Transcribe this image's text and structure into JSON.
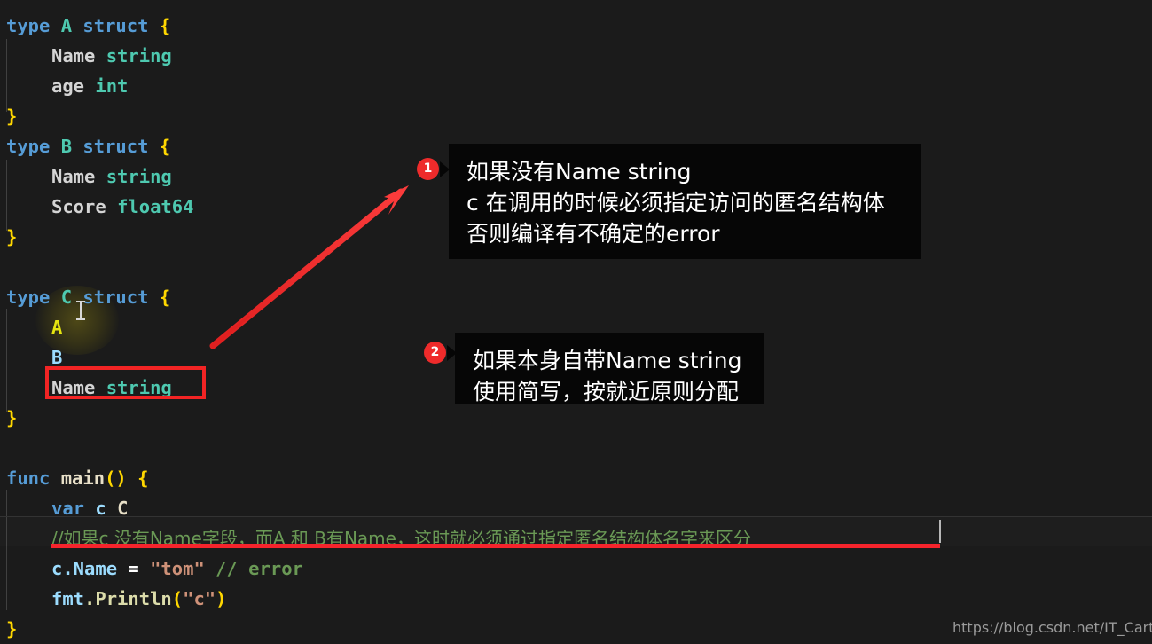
{
  "editor": {
    "background_color": "#1b1b1b",
    "language": "go",
    "lines": [
      {
        "n": 1,
        "indent": 0,
        "tokens": [
          {
            "t": "type ",
            "c": "kw"
          },
          {
            "t": "A",
            "c": "typ"
          },
          {
            "t": " ",
            "c": "ident"
          },
          {
            "t": "struct",
            "c": "kw"
          },
          {
            "t": " ",
            "c": "ident"
          },
          {
            "t": "{",
            "c": "brace"
          }
        ]
      },
      {
        "n": 2,
        "indent": 1,
        "tokens": [
          {
            "t": "Name",
            "c": "ident"
          },
          {
            "t": " ",
            "c": "ident"
          },
          {
            "t": "string",
            "c": "typ"
          }
        ]
      },
      {
        "n": 3,
        "indent": 1,
        "tokens": [
          {
            "t": "age",
            "c": "ident"
          },
          {
            "t": " ",
            "c": "ident"
          },
          {
            "t": "int",
            "c": "typ"
          }
        ]
      },
      {
        "n": 4,
        "indent": 0,
        "tokens": [
          {
            "t": "}",
            "c": "brace"
          }
        ]
      },
      {
        "n": 5,
        "indent": 0,
        "tokens": [
          {
            "t": "type ",
            "c": "kw"
          },
          {
            "t": "B",
            "c": "typ"
          },
          {
            "t": " ",
            "c": "ident"
          },
          {
            "t": "struct",
            "c": "kw"
          },
          {
            "t": " ",
            "c": "ident"
          },
          {
            "t": "{",
            "c": "brace"
          }
        ]
      },
      {
        "n": 6,
        "indent": 1,
        "tokens": [
          {
            "t": "Name",
            "c": "ident"
          },
          {
            "t": " ",
            "c": "ident"
          },
          {
            "t": "string",
            "c": "typ"
          }
        ]
      },
      {
        "n": 7,
        "indent": 1,
        "tokens": [
          {
            "t": "Score",
            "c": "ident"
          },
          {
            "t": " ",
            "c": "ident"
          },
          {
            "t": "float64",
            "c": "typ"
          }
        ]
      },
      {
        "n": 8,
        "indent": 0,
        "tokens": [
          {
            "t": "}",
            "c": "brace"
          }
        ]
      },
      {
        "n": 9,
        "indent": 0,
        "tokens": []
      },
      {
        "n": 10,
        "indent": 0,
        "tokens": [
          {
            "t": "type ",
            "c": "kw"
          },
          {
            "t": "C",
            "c": "typ"
          },
          {
            "t": " ",
            "c": "ident"
          },
          {
            "t": "struct",
            "c": "kw"
          },
          {
            "t": " ",
            "c": "ident"
          },
          {
            "t": "{",
            "c": "brace"
          }
        ]
      },
      {
        "n": 11,
        "indent": 1,
        "tokens": [
          {
            "t": "A",
            "c": "yellow"
          }
        ]
      },
      {
        "n": 12,
        "indent": 1,
        "tokens": [
          {
            "t": "B",
            "c": "prop"
          }
        ]
      },
      {
        "n": 13,
        "indent": 1,
        "tokens": [
          {
            "t": "Name",
            "c": "ident"
          },
          {
            "t": " ",
            "c": "ident"
          },
          {
            "t": "string",
            "c": "typ"
          }
        ]
      },
      {
        "n": 14,
        "indent": 0,
        "tokens": [
          {
            "t": "}",
            "c": "brace"
          }
        ]
      },
      {
        "n": 15,
        "indent": 0,
        "tokens": []
      },
      {
        "n": 16,
        "indent": 0,
        "tokens": [
          {
            "t": "func ",
            "c": "kw"
          },
          {
            "t": "main",
            "c": "cream"
          },
          {
            "t": "()",
            "c": "brace"
          },
          {
            "t": " ",
            "c": "ident"
          },
          {
            "t": "{",
            "c": "brace"
          }
        ]
      },
      {
        "n": 17,
        "indent": 1,
        "tokens": [
          {
            "t": "var",
            "c": "kw"
          },
          {
            "t": " ",
            "c": "ident"
          },
          {
            "t": "c",
            "c": "prop"
          },
          {
            "t": " ",
            "c": "ident"
          },
          {
            "t": "C",
            "c": "cream"
          }
        ]
      },
      {
        "n": 18,
        "indent": 1,
        "tokens": [
          {
            "t": "//如果c 没有Name字段，而A 和 B有Name，这时就必须通过指定匿名结构体名字来区分",
            "c": "cmt"
          }
        ]
      },
      {
        "n": 19,
        "indent": 1,
        "tokens": [
          {
            "t": "c",
            "c": "prop"
          },
          {
            "t": ".Name",
            "c": "prop"
          },
          {
            "t": " ",
            "c": "ident"
          },
          {
            "t": "=",
            "c": "white"
          },
          {
            "t": " ",
            "c": "ident"
          },
          {
            "t": "\"tom\"",
            "c": "str"
          },
          {
            "t": " ",
            "c": "ident"
          },
          {
            "t": "// error",
            "c": "cmt"
          }
        ]
      },
      {
        "n": 20,
        "indent": 1,
        "tokens": [
          {
            "t": "fmt",
            "c": "prop"
          },
          {
            "t": ".Println",
            "c": "fn"
          },
          {
            "t": "(",
            "c": "brace"
          },
          {
            "t": "\"c\"",
            "c": "str"
          },
          {
            "t": ")",
            "c": "brace"
          }
        ]
      },
      {
        "n": 21,
        "indent": 0,
        "tokens": [
          {
            "t": "}",
            "c": "brace"
          }
        ]
      }
    ],
    "cursor_line": 18,
    "highlighted_identifier": "A",
    "boxed_code": "Name string"
  },
  "annotations": [
    {
      "number": "1",
      "text": "如果没有Name string\nc 在调用的时候必须指定访问的匿名结构体\n否则编译有不确定的error",
      "badge_color": "#ee2b2b",
      "box_color": "#060606"
    },
    {
      "number": "2",
      "text": "如果本身自带Name string\n使用简写，按就近原则分配",
      "badge_color": "#ee2b2b",
      "box_color": "#060606"
    }
  ],
  "markup": {
    "arrow_color": "#f6242c",
    "red_box_color": "#f22424",
    "red_underline_color": "#f6242c"
  },
  "watermark": {
    "text": "https://blog.csdn.net/IT_Carter"
  }
}
